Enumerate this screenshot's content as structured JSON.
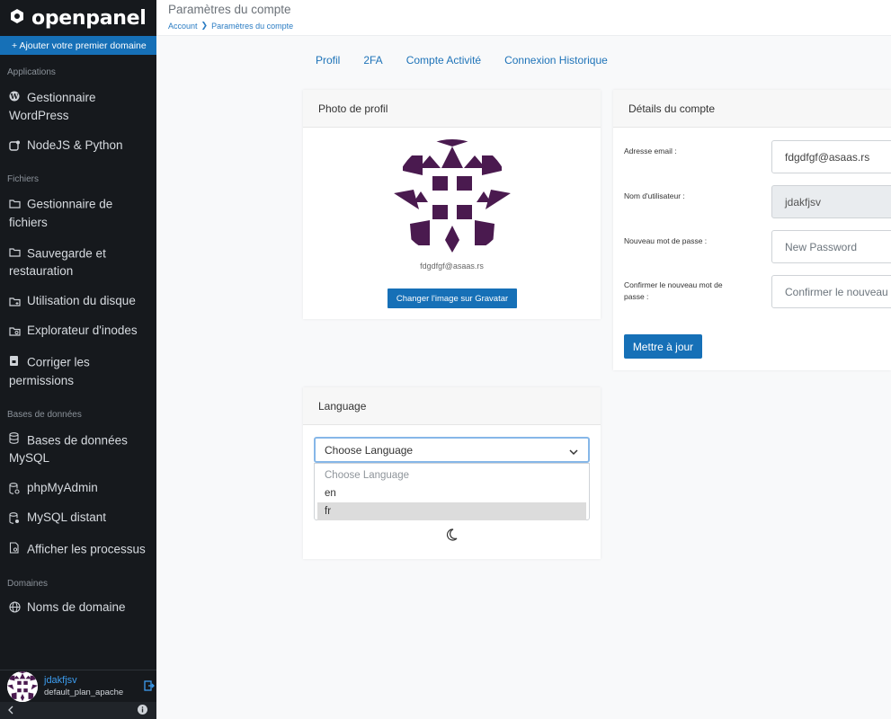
{
  "app": {
    "brand": "openpanel"
  },
  "sidebar": {
    "add_domain": "+ Ajouter votre premier domaine",
    "sections": {
      "applications": "Applications",
      "files": "Fichiers",
      "databases": "Bases de données",
      "domains": "Domaines"
    },
    "items": {
      "wordpress": "Gestionnaire WordPress",
      "nodejs": "NodeJS & Python",
      "file_manager": "Gestionnaire de fichiers",
      "backup": "Sauvegarde et restauration",
      "disk_usage": "Utilisation du disque",
      "inodes": "Explorateur d'inodes",
      "permissions": "Corriger les permissions",
      "mysql": "Bases de données MySQL",
      "phpmyadmin": "phpMyAdmin",
      "remote_mysql": "MySQL distant",
      "processes": "Afficher les processus",
      "domain_names": "Noms de domaine"
    },
    "user": {
      "name": "jdakfjsv",
      "plan": "default_plan_apache"
    }
  },
  "header": {
    "title": "Paramètres du compte",
    "breadcrumb": [
      "Account",
      "Paramètres du compte"
    ]
  },
  "tabs": [
    "Profil",
    "2FA",
    "Compte Activité",
    "Connexion Historique"
  ],
  "photo_card": {
    "title": "Photo de profil",
    "email": "fdgdfgf@asaas.rs",
    "button": "Changer l'image sur Gravatar"
  },
  "account_card": {
    "title": "Détails du compte",
    "email_label": "Adresse email :",
    "email_value": "fdgdfgf@asaas.rs",
    "username_label": "Nom d'utilisateur :",
    "username_value": "jdakfjsv",
    "new_password_label": "Nouveau mot de passe :",
    "new_password_placeholder": "New Password",
    "confirm_label": "Confirmer le nouveau mot de passe :",
    "confirm_placeholder": "Confirmer le nouveau mot de passe",
    "update_button": "Mettre à jour"
  },
  "language_card": {
    "title": "Language",
    "selected": "Choose Language",
    "options": [
      "Choose Language",
      "en",
      "fr"
    ],
    "highlighted": "fr"
  },
  "colors": {
    "accent": "#1670b7",
    "sidebar_bg": "#16191d",
    "avatar": "#4a1a4f"
  }
}
